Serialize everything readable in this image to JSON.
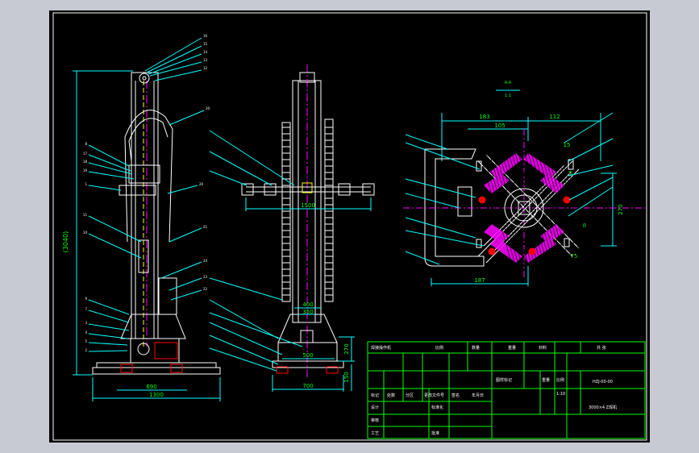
{
  "colors": {
    "outer_bg": "#c7cad3",
    "sheet_bg": "#000000",
    "frame": "#ffffff",
    "cyan": "#00ffff",
    "green": "#00ff00",
    "white": "#ffffff",
    "red": "#ff0000",
    "magenta": "#ff00ff",
    "yellow": "#ffff00"
  },
  "left_view": {
    "callouts": [
      "16",
      "15",
      "14",
      "13",
      "12",
      "20",
      "8",
      "17",
      "18",
      "19",
      "1",
      "11",
      "10",
      "9",
      "7",
      "3",
      "4",
      "5",
      "1",
      "2",
      "24",
      "23",
      "22",
      "21",
      "20",
      "25"
    ],
    "dims": {
      "height": "(3040)",
      "base": "690",
      "overall": "1300"
    }
  },
  "middle_view": {
    "callouts": [
      "33",
      "32",
      "31",
      "25",
      "26",
      "27",
      "28",
      "29",
      "30"
    ],
    "dims": {
      "span": "1500",
      "w1": "400",
      "w2": "350",
      "w3": "500",
      "base": "700",
      "h1": "270",
      "h2": "150"
    }
  },
  "section_view": {
    "label_top": "A-A",
    "label_sub": "1:1",
    "dims": {
      "top_left": "183",
      "top_right": "112",
      "inner": "105",
      "bottom": "187",
      "right": "270",
      "diag1": "75",
      "diag2": "8",
      "small": "15",
      "small2": "5"
    },
    "callouts_left": [
      "9",
      "10",
      "11",
      "12",
      "13",
      "14"
    ],
    "callouts_right": [
      "9",
      "8",
      "7",
      "6",
      "5",
      "4"
    ]
  },
  "title_block": {
    "r1": [
      "焊接操作机",
      "比例",
      "数量",
      "重量",
      "材料",
      "共 张",
      "第 张"
    ],
    "r2": [
      "设计",
      "审核",
      "工艺"
    ],
    "mid": [
      "标记",
      "处数",
      "分区",
      "更改文件号",
      "签名",
      "年月日"
    ],
    "right": [
      "图样标记",
      "重量",
      "比例"
    ],
    "drawing_no": "HZJ-00-00",
    "name": "3000×4 Z焊机",
    "scale": "1:10",
    "rows_left": [
      "设计",
      "标准化",
      "审核",
      "工艺",
      "批准"
    ]
  }
}
